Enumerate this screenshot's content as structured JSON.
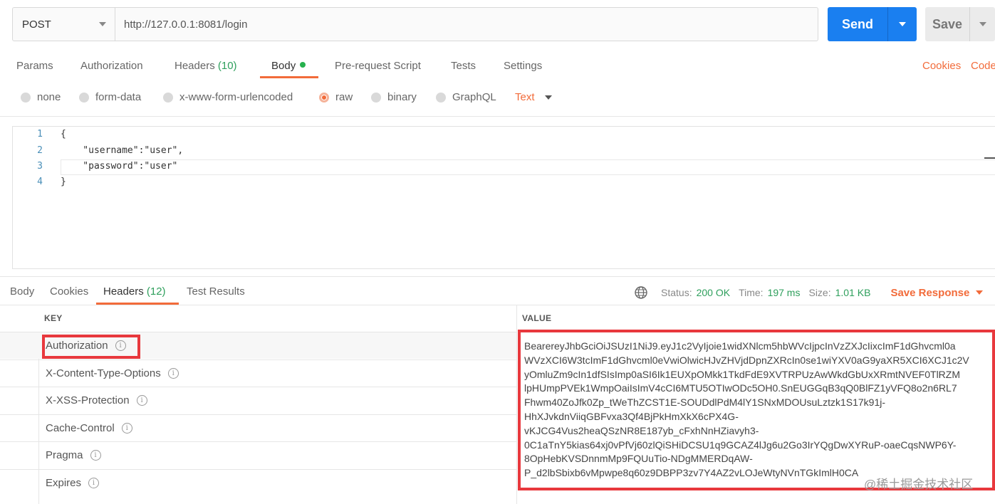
{
  "request": {
    "method": "POST",
    "url": "http://127.0.0.1:8081/login",
    "send_label": "Send",
    "save_label": "Save"
  },
  "request_tabs": [
    {
      "label": "Params"
    },
    {
      "label": "Authorization"
    },
    {
      "label": "Headers",
      "count": "(10)"
    },
    {
      "label": "Body"
    },
    {
      "label": "Pre-request Script"
    },
    {
      "label": "Tests"
    },
    {
      "label": "Settings"
    }
  ],
  "request_links": {
    "cookies": "Cookies",
    "code": "Code"
  },
  "body_types": [
    {
      "label": "none"
    },
    {
      "label": "form-data"
    },
    {
      "label": "x-www-form-urlencoded"
    },
    {
      "label": "raw",
      "selected": true
    },
    {
      "label": "binary"
    },
    {
      "label": "GraphQL"
    }
  ],
  "body_format": "Text",
  "editor": {
    "line_numbers": [
      "1",
      "2",
      "3",
      "4"
    ],
    "lines": [
      "{",
      "    \"username\":\"user\",",
      "    \"password\":\"user\"",
      "}"
    ]
  },
  "response_tabs": [
    {
      "label": "Body"
    },
    {
      "label": "Cookies"
    },
    {
      "label": "Headers",
      "count": "(12)"
    },
    {
      "label": "Test Results"
    }
  ],
  "status": {
    "status_label": "Status:",
    "status_value": "200 OK",
    "time_label": "Time:",
    "time_value": "197 ms",
    "size_label": "Size:",
    "size_value": "1.01 KB",
    "save_response": "Save Response"
  },
  "headers_table": {
    "key_header": "KEY",
    "value_header": "VALUE",
    "rows": [
      {
        "key": "Authorization"
      },
      {
        "key": "X-Content-Type-Options"
      },
      {
        "key": "X-XSS-Protection"
      },
      {
        "key": "Cache-Control"
      },
      {
        "key": "Pragma"
      },
      {
        "key": "Expires"
      }
    ],
    "authorization_value": "BearereyJhbGciOiJSUzI1NiJ9.eyJ1c2VyIjoie1widXNlcm5hbWVcIjpcInVzZXJcIixcImF1dGhvcml0a\nWVzXCI6W3tcImF1dGhvcml0eVwiOlwicHJvZHVjdDpnZXRcIn0se1wiYXV0aG9yaXR5XCI6XCJ1c2V\nyOmluZm9cIn1dfSIsImp0aSI6Ik1EUXpOMkk1TkdFdE9XVTRPUzAwWkdGbUxXRmtNVEF0TlRZM\nlpHUmpPVEk1WmpOaiIsImV4cCI6MTU5OTIwODc5OH0.SnEUGGqB3qQ0BlFZ1yVFQ8o2n6RL7\nFhwm40ZoJfk0Zp_tWeThZCST1E-SOUDdlPdM4lY1SNxMDOUsuLztzk1S17k91j-\nHhXJvkdnViiqGBFvxa3Qf4BjPkHmXkX6cPX4G-\nvKJCG4Vus2heaQSzNR8E187yb_cFxhNnHZiavyh3-\n0C1aTnY5kias64xj0vPfVj60zlQiSHiDCSU1q9GCAZ4lJg6u2Go3IrYQgDwXYRuP-oaeCqsNWP6Y-\n8OpHebKVSDnnmMp9FQUuTio-NDgMMERDqAW-\nP_d2lbSbixb6vMpwpe8q60z9DBPP3zv7Y4AZ2vLOJeWtyNVnTGkImlH0CA"
  },
  "watermark": "@稀土掘金技术社区",
  "colors": {
    "accent": "#f26b3a",
    "send": "#1a7ff0",
    "success": "#2e9f5c",
    "highlight_box": "#e8383d"
  }
}
